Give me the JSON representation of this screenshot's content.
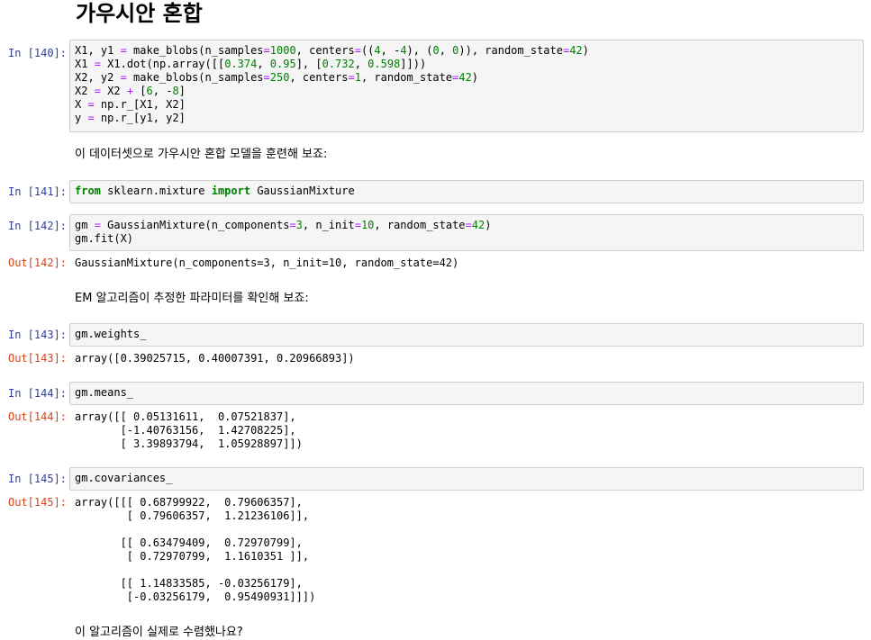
{
  "heading": "가우시안 혼합",
  "cells": {
    "c140": {
      "prompt": "In [140]:",
      "lines": [
        "X1, y1 = make_blobs(n_samples=1000, centers=((4, -4), (0, 0)), random_state=42)",
        "X1 = X1.dot(np.array([[0.374, 0.95], [0.732, 0.598]]))",
        "X2, y2 = make_blobs(n_samples=250, centers=1, random_state=42)",
        "X2 = X2 + [6, -8]",
        "X = np.r_[X1, X2]",
        "y = np.r_[y1, y2]"
      ]
    },
    "md1": "이 데이터셋으로 가우시안 혼합 모델을 훈련해 보죠:",
    "c141": {
      "prompt": "In [141]:",
      "lines": [
        "from sklearn.mixture import GaussianMixture"
      ]
    },
    "c142": {
      "prompt": "In [142]:",
      "lines": [
        "gm = GaussianMixture(n_components=3, n_init=10, random_state=42)",
        "gm.fit(X)"
      ],
      "out_prompt": "Out[142]:",
      "output": "GaussianMixture(n_components=3, n_init=10, random_state=42)"
    },
    "md2": "EM 알고리즘이 추정한 파라미터를 확인해 보죠:",
    "c143": {
      "prompt": "In [143]:",
      "lines": [
        "gm.weights_"
      ],
      "out_prompt": "Out[143]:",
      "output": "array([0.39025715, 0.40007391, 0.20966893])"
    },
    "c144": {
      "prompt": "In [144]:",
      "lines": [
        "gm.means_"
      ],
      "out_prompt": "Out[144]:",
      "output": "array([[ 0.05131611,  0.07521837],\n       [-1.40763156,  1.42708225],\n       [ 3.39893794,  1.05928897]])"
    },
    "c145": {
      "prompt": "In [145]:",
      "lines": [
        "gm.covariances_"
      ],
      "out_prompt": "Out[145]:",
      "output": "array([[[ 0.68799922,  0.79606357],\n        [ 0.79606357,  1.21236106]],\n\n       [[ 0.63479409,  0.72970799],\n        [ 0.72970799,  1.1610351 ]],\n\n       [[ 1.14833585, -0.03256179],\n        [-0.03256179,  0.95490931]]])"
    },
    "md3": "이 알고리즘이 실제로 수렴했나요?"
  }
}
